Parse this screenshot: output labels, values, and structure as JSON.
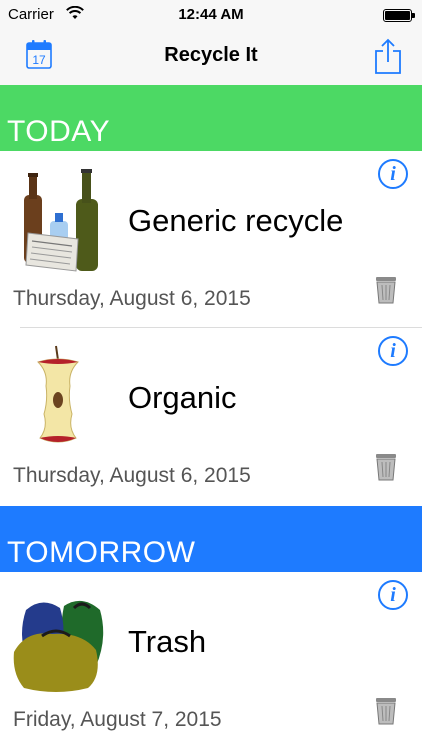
{
  "status_bar": {
    "carrier": "Carrier",
    "time": "12:44 AM"
  },
  "nav": {
    "title": "Recycle It",
    "calendar_icon_day": "17",
    "left_icon": "calendar-icon",
    "right_icon": "share-icon"
  },
  "sections": [
    {
      "header": "TODAY",
      "color": "#4cd964",
      "items": [
        {
          "name": "Generic recycle",
          "date": "Thursday, August 6, 2015",
          "icon": "recycle-bottles-icon"
        },
        {
          "name": "Organic",
          "date": "Thursday, August 6, 2015",
          "icon": "apple-core-icon"
        }
      ]
    },
    {
      "header": "TOMORROW",
      "color": "#1e7bff",
      "items": [
        {
          "name": "Trash",
          "date": "Friday, August 7, 2015",
          "icon": "trash-bags-icon"
        }
      ]
    }
  ],
  "colors": {
    "accent": "#1e7bff",
    "today": "#4cd964",
    "tomorrow": "#1e7bff"
  }
}
